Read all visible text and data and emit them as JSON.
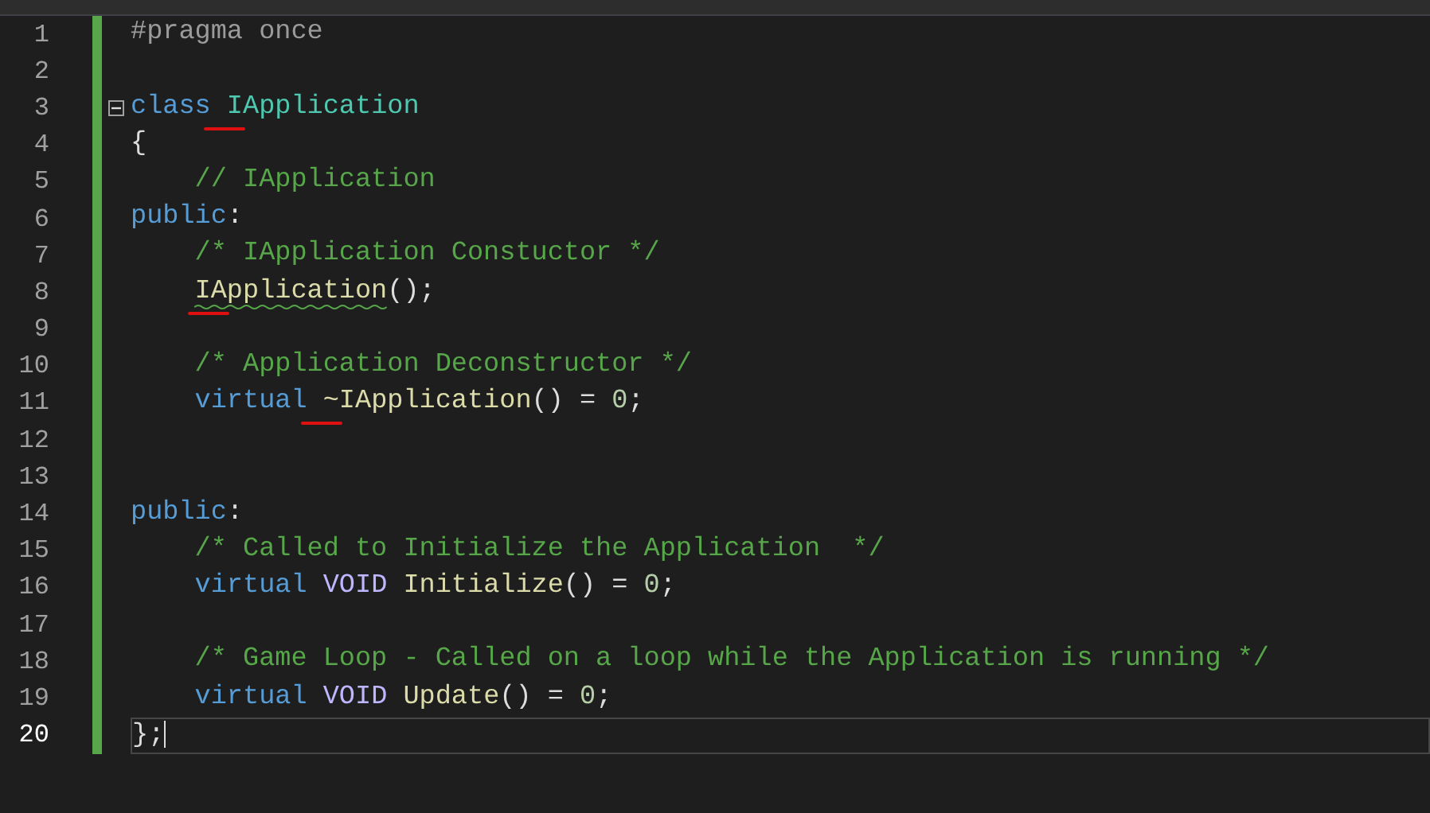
{
  "lines": [
    {
      "number": "1",
      "current": false,
      "indented": false,
      "tokens": [
        {
          "text": "#pragma once",
          "kind": "preprocessor"
        }
      ]
    },
    {
      "number": "2",
      "current": false
    },
    {
      "number": "3",
      "current": false,
      "expanded": true,
      "indented": false,
      "tokens": [
        {
          "text": "class",
          "kind": "keyword"
        },
        {
          "text": " IApplication",
          "kind": "class",
          "marked": true
        }
      ]
    },
    {
      "number": "4",
      "current": false,
      "indented": false,
      "tokens": [
        {
          "text": "{",
          "kind": "plain"
        }
      ]
    },
    {
      "number": "5",
      "current": false,
      "indented": true,
      "tokens": [
        {
          "text": "// IApplication",
          "kind": "comment"
        }
      ]
    },
    {
      "number": "6",
      "current": false,
      "indented": false,
      "tokens": [
        {
          "text": "public",
          "kind": "keyword"
        },
        {
          "text": ":",
          "kind": "plain"
        }
      ]
    },
    {
      "number": "7",
      "current": false,
      "indented": true,
      "tokens": [
        {
          "text": "/* IApplication Constuctor */",
          "kind": "comment"
        }
      ]
    },
    {
      "number": "8",
      "current": false,
      "indented": true,
      "tokens": [
        {
          "text": "IApplication",
          "kind": "function",
          "marked": true,
          "squiggle": true
        },
        {
          "text": "();",
          "kind": "plain"
        }
      ]
    },
    {
      "number": "9",
      "current": false
    },
    {
      "number": "10",
      "current": false,
      "indented": true,
      "tokens": [
        {
          "text": "/* Application Deconstructor */",
          "kind": "comment"
        }
      ]
    },
    {
      "number": "11",
      "current": false,
      "indented": true,
      "tokens": [
        {
          "text": "virtual",
          "kind": "keyword"
        },
        {
          "text": " ~IApplication",
          "kind": "function",
          "marked": true
        },
        {
          "text": "() = ",
          "kind": "plain"
        },
        {
          "text": "0",
          "kind": "number"
        },
        {
          "text": ";",
          "kind": "plain"
        }
      ]
    },
    {
      "number": "12",
      "current": false
    },
    {
      "number": "13",
      "current": false
    },
    {
      "number": "14",
      "current": false,
      "indented": false,
      "tokens": [
        {
          "text": "public",
          "kind": "keyword"
        },
        {
          "text": ":",
          "kind": "plain"
        }
      ]
    },
    {
      "number": "15",
      "current": false,
      "indented": true,
      "tokens": [
        {
          "text": "/* Called to Initialize the Application  */",
          "kind": "comment"
        }
      ]
    },
    {
      "number": "16",
      "current": false,
      "indented": true,
      "tokens": [
        {
          "text": "virtual",
          "kind": "keyword"
        },
        {
          "text": " VOID",
          "kind": "macro"
        },
        {
          "text": " Initialize",
          "kind": "function"
        },
        {
          "text": "() = ",
          "kind": "plain"
        },
        {
          "text": "0",
          "kind": "number"
        },
        {
          "text": ";",
          "kind": "plain"
        }
      ]
    },
    {
      "number": "17",
      "current": false
    },
    {
      "number": "18",
      "current": false,
      "indented": true,
      "tokens": [
        {
          "text": "/* Game Loop - Called on a loop while the Application is running */",
          "kind": "comment"
        }
      ]
    },
    {
      "number": "19",
      "current": false,
      "indented": true,
      "tokens": [
        {
          "text": "virtual",
          "kind": "keyword"
        },
        {
          "text": " VOID",
          "kind": "macro"
        },
        {
          "text": " Update",
          "kind": "function"
        },
        {
          "text": "() = ",
          "kind": "plain"
        },
        {
          "text": "0",
          "kind": "number"
        },
        {
          "text": ";",
          "kind": "plain"
        }
      ]
    },
    {
      "number": "20",
      "current": true,
      "indented": false,
      "tokens": [
        {
          "text": "};",
          "kind": "plain"
        }
      ]
    }
  ]
}
